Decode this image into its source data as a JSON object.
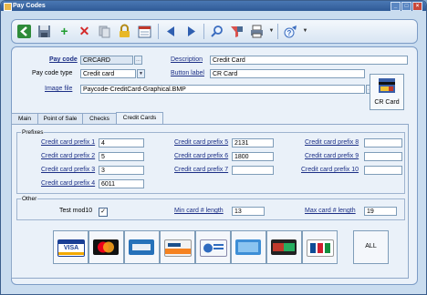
{
  "window": {
    "title": "Pay Codes",
    "controls": [
      "_",
      "□",
      "×"
    ]
  },
  "toolbar": {
    "icons": [
      "exit-icon",
      "save-icon",
      "add-icon",
      "delete-icon",
      "copy-icon",
      "lock-icon",
      "calendar-icon",
      "previous-icon",
      "next-icon",
      "search-icon",
      "filter-icon",
      "print-icon",
      "help-icon"
    ]
  },
  "header": {
    "pay_code_label": "Pay code",
    "pay_code_value": "CRCARD",
    "description_label": "Description",
    "description_value": "Credit Card",
    "pay_code_type_label": "Pay code type",
    "pay_code_type_value": "Credit card",
    "button_label_label": "Button label",
    "button_label_value": "CR Card",
    "image_file_label": "Image file",
    "image_file_value": "Paycode-CreditCard-Graphical.BMP",
    "preview_label": "CR Card"
  },
  "tabs": [
    "Main",
    "Point of Sale",
    "Checks",
    "Credit Cards"
  ],
  "active_tab": "Credit Cards",
  "prefixes": {
    "group_label": "Prefixes",
    "col1": [
      {
        "label": "Credit card prefix 1",
        "value": "4"
      },
      {
        "label": "Credit card prefix 2",
        "value": "5"
      },
      {
        "label": "Credit card prefix 3",
        "value": "3"
      },
      {
        "label": "Credit card prefix 4",
        "value": "6011"
      }
    ],
    "col2": [
      {
        "label": "Credit card prefix 5",
        "value": "2131"
      },
      {
        "label": "Credit card prefix 6",
        "value": "1800"
      },
      {
        "label": "Credit card prefix 7",
        "value": ""
      }
    ],
    "col3": [
      {
        "label": "Credit card prefix 8",
        "value": ""
      },
      {
        "label": "Credit card prefix 9",
        "value": ""
      },
      {
        "label": "Credit card prefix 10",
        "value": ""
      }
    ]
  },
  "other": {
    "group_label": "Other",
    "test_mod10_label": "Test mod10",
    "test_mod10_checked": true,
    "min_len_label": "Min card # length",
    "min_len_value": "13",
    "max_len_label": "Max card # length",
    "max_len_value": "19"
  },
  "card_logos": [
    {
      "name": "visa",
      "text": "VISA"
    },
    {
      "name": "mastercard",
      "text": "MasterCard"
    },
    {
      "name": "amex",
      "text": "AMERICAN EXPRESS"
    },
    {
      "name": "discover",
      "text": "DISCOVER"
    },
    {
      "name": "diners",
      "text": "Diners Club"
    },
    {
      "name": "generic-card",
      "text": ""
    },
    {
      "name": "enroute",
      "text": "enRoute"
    },
    {
      "name": "jcb",
      "text": "JCB"
    }
  ],
  "all_label": "ALL",
  "colors": {
    "title_bar": "#2f5a96",
    "panel": "#eaf1f9",
    "accent": "#1c2f86"
  }
}
